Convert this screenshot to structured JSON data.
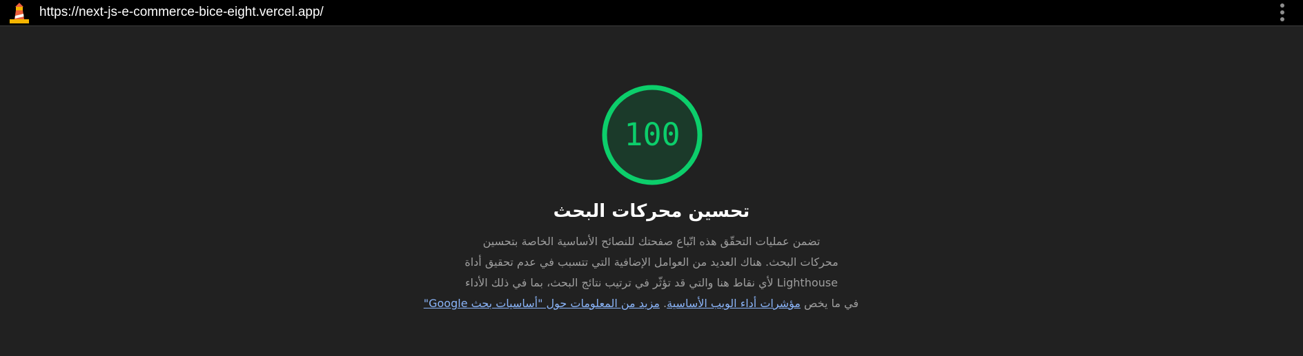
{
  "topbar": {
    "url": "https://next-js-e-commerce-bice-eight.vercel.app/",
    "logo_icon": "lighthouse-icon",
    "menu_icon": "vertical-dots-menu-icon"
  },
  "category": {
    "score": "100",
    "score_fraction": 1.0,
    "score_color": "#0cce6b",
    "title": "تحسين محركات البحث",
    "description": {
      "line1": "تضمن عمليات التحقّق هذه اتّباع صفحتك للنصائح الأساسية الخاصة بتحسين",
      "line2": "محركات البحث. هناك العديد من العوامل الإضافية التي تتسبب في عدم تحقيق أداة",
      "line3": "Lighthouse لأي نقاط هنا والتي قد تؤثّر في ترتيب نتائج البحث، بما في ذلك الأداء",
      "line4_prefix": "في ما يخص",
      "link_vitals": "مؤشرات أداء الويب الأساسية",
      "separator": ".",
      "link_more": "مزيد من المعلومات حول \"أساسيات بحث Google\""
    }
  }
}
